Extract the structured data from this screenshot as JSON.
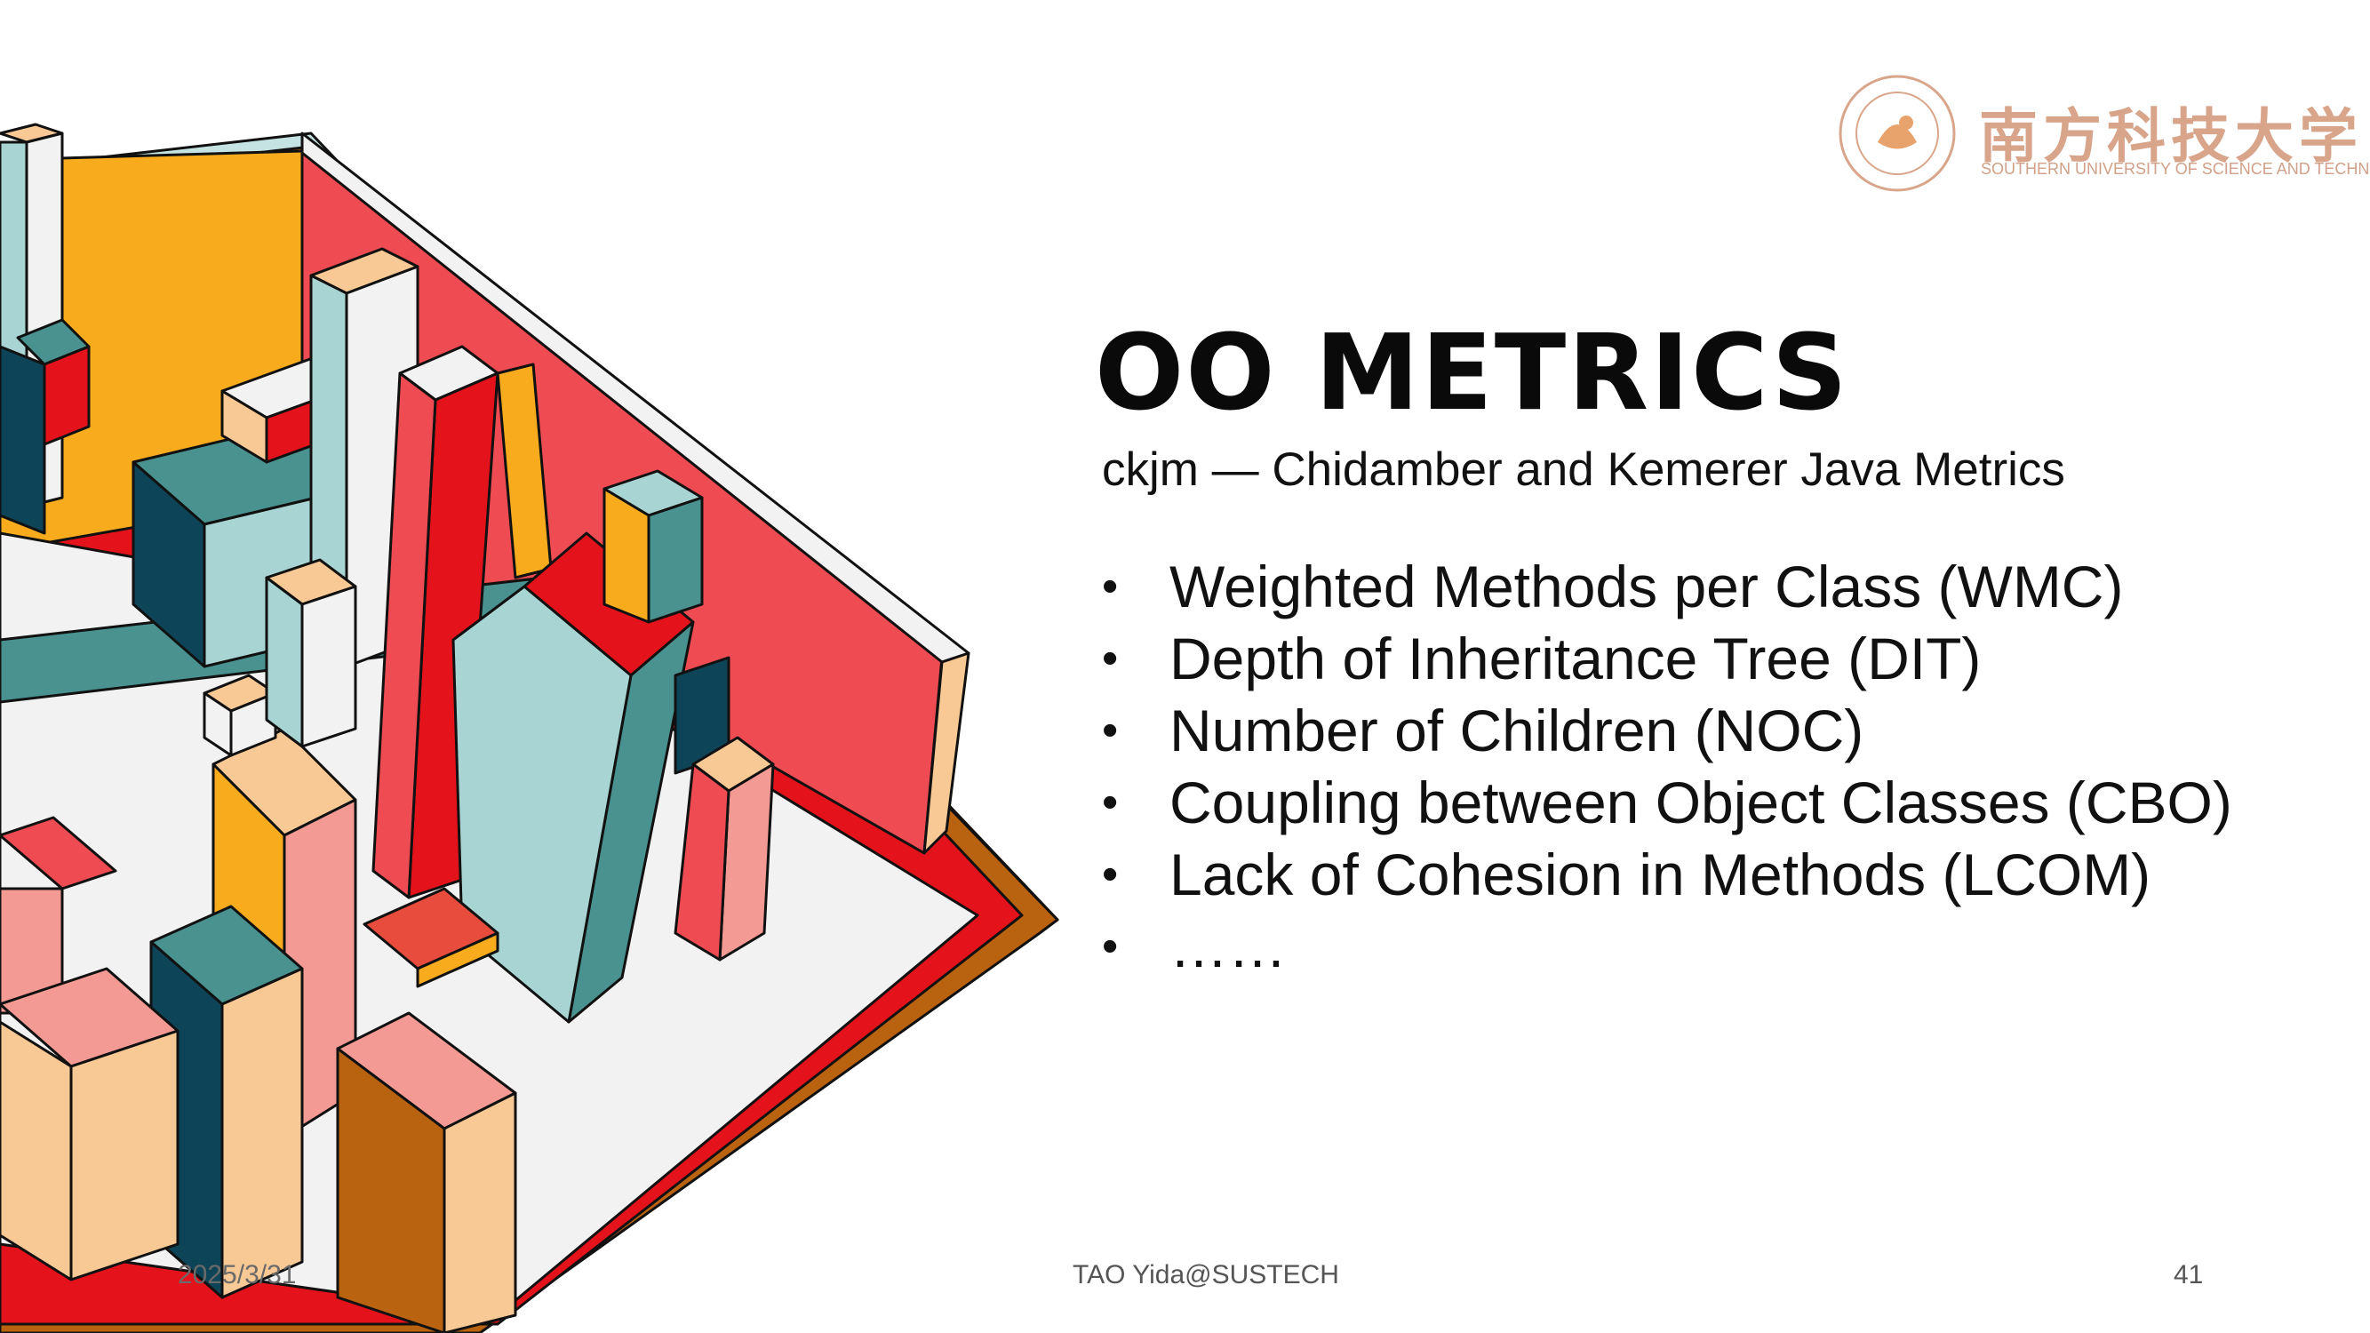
{
  "slide": {
    "title": "OO METRICS",
    "subtitle": "ckjm — Chidamber and Kemerer Java Metrics",
    "bullet_char": "•",
    "bullets": [
      "Weighted Methods per Class (WMC)",
      "Depth of Inheritance Tree (DIT)",
      "Number of Children (NOC)",
      "Coupling between Object Classes (CBO)",
      "Lack of Cohesion in Methods (LCOM)",
      "……"
    ]
  },
  "logo": {
    "chinese_name": "南方科技大学",
    "english_name": "SOUTHERN UNIVERSITY OF SCIENCE AND TECHNOLOGY",
    "color": "#d9a58b"
  },
  "footer": {
    "date": "2025/3/31",
    "author": "TAO Yida@SUSTECH",
    "page_number": "41"
  },
  "palette": {
    "red": "#e3121b",
    "coral": "#ee4b52",
    "peach": "#f9c995",
    "pink": "#f29a93",
    "teal": "#4a9290",
    "mint": "#a8d5d3",
    "navy": "#0d4457",
    "yellow": "#f7ab1d",
    "brown": "#b9620f",
    "offwhite": "#f2f2f2"
  }
}
